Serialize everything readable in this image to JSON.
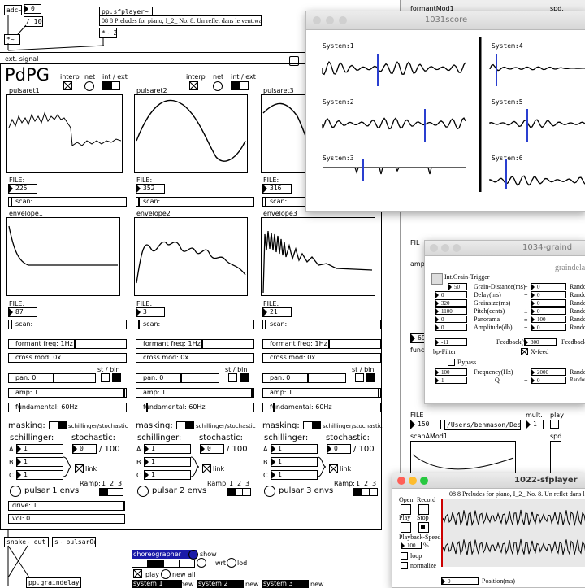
{
  "topleft": {
    "adc": "adc~",
    "n0": "0",
    "div100": "/ 100",
    "mul0": "*~ 0",
    "sfplayer": "pp.sfplayer~",
    "track": "08 8 Preludes for piano, I_2_ No. 8. Un reflet dans le vent.wav",
    "mul2": "*~ 2",
    "extsignal": "ext. signal"
  },
  "pdpg": {
    "title": "PdPG",
    "interp": "interp",
    "net": "net",
    "intext": "int / ext"
  },
  "columns": [
    {
      "pulsaret": "pulsaret1",
      "file_label": "FILE:",
      "pfile": "225",
      "scan": "scan:",
      "envelope": "envelope1",
      "efile": "87",
      "formant": "formant freq: 1Hz",
      "cross": "cross mod: 0x",
      "pan": "pan: 0",
      "stbin": "st / bin",
      "amp": "amp: 1",
      "fund": "fundamental: 60Hz",
      "masking": "masking:",
      "schill_stoch": "schillinger/stochastic",
      "schillinger": "schillinger:",
      "stochastic": "stochastic:",
      "A": "1",
      "B": "1",
      "C": "1",
      "stoch_val": "0",
      "over100": "/ 100",
      "link": "link",
      "ramp": "Ramp:",
      "r1": "1",
      "r2": "2",
      "r3": "3",
      "envs": "pulsar 1 envs"
    },
    {
      "pulsaret": "pulsaret2",
      "file_label": "FILE:",
      "pfile": "352",
      "scan": "scan:",
      "envelope": "envelope2",
      "efile": "3",
      "formant": "formant freq: 1Hz",
      "cross": "cross mod: 0x",
      "pan": "pan: 0",
      "stbin": "st / bin",
      "amp": "amp: 1",
      "fund": "fundamental: 60Hz",
      "masking": "masking:",
      "schill_stoch": "schillinger/stochastic",
      "schillinger": "schillinger:",
      "stochastic": "stochastic:",
      "A": "1",
      "B": "1",
      "C": "1",
      "stoch_val": "0",
      "over100": "/ 100",
      "link": "link",
      "ramp": "Ramp:",
      "r1": "1",
      "r2": "2",
      "r3": "3",
      "envs": "pulsar 2 envs"
    },
    {
      "pulsaret": "pulsaret3",
      "file_label": "FILE:",
      "pfile": "316",
      "scan": "scan:",
      "envelope": "envelope3",
      "efile": "21",
      "formant": "formant freq: 1Hz",
      "cross": "cross mod: 0x",
      "pan": "pan: 0",
      "stbin": "st / bin",
      "amp": "amp: 1",
      "fund": "fundamental: 60Hz",
      "masking": "masking:",
      "schill_stoch": "schillinger/stochastic",
      "schillinger": "schillinger:",
      "stochastic": "stochastic:",
      "A": "1",
      "B": "1",
      "C": "1",
      "stoch_val": "0",
      "over100": "/ 100",
      "link": "link",
      "ramp": "Ramp:",
      "r1": "1",
      "r2": "2",
      "r3": "3",
      "envs": "pulsar 3 envs"
    }
  ],
  "bottom": {
    "drive": "drive: 1",
    "vol": "vol: 0",
    "snake": "snake~ out 2",
    "send": "s~ pulsarOut",
    "graindelay": "pp.graindelay~",
    "choreographer": "choreographer",
    "show": "show",
    "wrt": "wrt",
    "lod": "lod",
    "play": "play",
    "newall": "new all",
    "sys1": "system 1",
    "sys2": "system 2",
    "sys3": "system 3",
    "new": "new"
  },
  "formantmod": {
    "title": "formantMod1",
    "spd": "spd.",
    "file": "FILE",
    "n150": "150",
    "path": "/Users/benmason/Deskt",
    "mult": "mult.",
    "n1": "1",
    "play": "play",
    "scan": "scanAMod1",
    "spd2": "spd.",
    "fil": "FIL",
    "amp": "amp",
    "n69": "69",
    "func": "func"
  },
  "score": {
    "title": "1031score",
    "s1": "System:1",
    "s2": "System:2",
    "s3": "System:3",
    "s4": "System:4",
    "s5": "System:5",
    "s6": "System:6"
  },
  "grain": {
    "title": "1034-graind",
    "brand": "graindela",
    "trigger": "Int.Grain-Trigger",
    "dist": "Grain-Distance(ms)",
    "delay": "Delay(ms)",
    "size": "Grainsize(ms)",
    "pitch": "Pitch(cents)",
    "pan": "Panorama",
    "amp": "Amplitude(db)",
    "feedback": "Feedback(%)",
    "feedback2": "Feedback",
    "xfeed": "X-feed",
    "bpf": "bp-Filter",
    "bypass": "Bypass",
    "freq": "Frequency(Hz)",
    "q": "Q",
    "random": "Rando",
    "random2": "Random",
    "v50": "50",
    "v0": "0",
    "v320": "320",
    "v1100": "1100",
    "v100": "100",
    "vm11": "-11",
    "v800": "800",
    "v2000": "2000",
    "vq1": "1",
    "pm": "±",
    "plus": "+"
  },
  "sfplayer": {
    "title": "1022-sfplayer",
    "open": "Open",
    "record": "Record",
    "play": "Play",
    "stop": "Stop",
    "speed": "Playback-Speed",
    "speedval": "100",
    "pct": "%",
    "loop": "loop",
    "normalize": "normalize",
    "track": "08 8 Preludes for piano, I_2_ No. 8. Un reflet dans le vent.wav",
    "posval": "0",
    "position": "Position(ms)"
  },
  "colors": {
    "accent": "#2a3fd0",
    "red": "#ff5f57",
    "yellow": "#febc2e",
    "green": "#28c840",
    "choreo": "#1a1aa8"
  }
}
